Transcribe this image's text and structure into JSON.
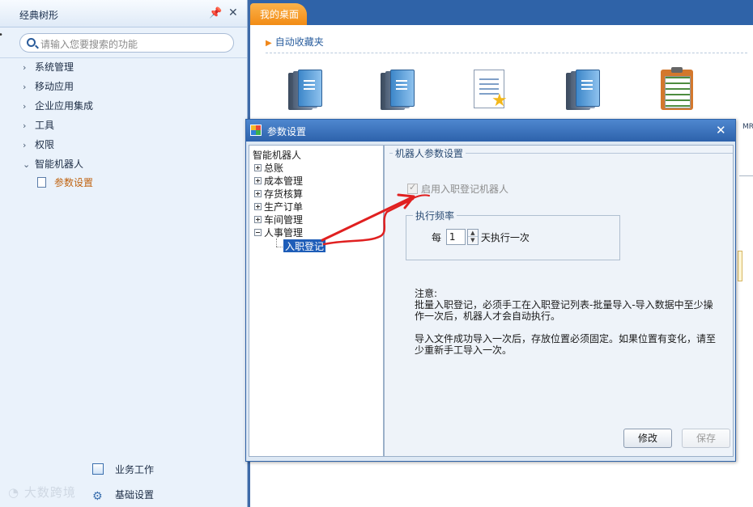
{
  "left_panel": {
    "title": "经典树形",
    "search_placeholder": "请输入您要搜索的功能",
    "menu": [
      {
        "label": "系统管理",
        "arrow": "›"
      },
      {
        "label": "移动应用",
        "arrow": "›"
      },
      {
        "label": "企业应用集成",
        "arrow": "›"
      },
      {
        "label": "工具",
        "arrow": "›"
      },
      {
        "label": "权限",
        "arrow": "›"
      },
      {
        "label": "智能机器人",
        "arrow": "⌄"
      }
    ],
    "submenu_item": "参数设置",
    "bottom": [
      {
        "label": "业务工作"
      },
      {
        "label": "基础设置"
      }
    ],
    "watermark": "大数跨境"
  },
  "tabs": [
    {
      "label": "我的桌面"
    }
  ],
  "favorites": {
    "header": "自动收藏夹",
    "partial_label": "MR",
    "icons": [
      "books-icon",
      "books-icon",
      "document-star-icon",
      "books-icon",
      "clipboard-icon"
    ]
  },
  "dialog": {
    "title": "参数设置",
    "tree": {
      "root": "智能机器人",
      "nodes": [
        {
          "label": "总账",
          "state": "collapsed"
        },
        {
          "label": "成本管理",
          "state": "collapsed"
        },
        {
          "label": "存货核算",
          "state": "collapsed"
        },
        {
          "label": "生产订单",
          "state": "collapsed"
        },
        {
          "label": "车间管理",
          "state": "collapsed"
        },
        {
          "label": "人事管理",
          "state": "expanded"
        }
      ],
      "selected_leaf": "入职登记"
    },
    "settings": {
      "group_title": "机器人参数设置",
      "enable_checkbox_label": "启用入职登记机器人",
      "enable_checked": true,
      "frequency": {
        "legend": "执行频率",
        "prefix": "每",
        "value": "1",
        "suffix": "天执行一次"
      },
      "note_title": "注意:",
      "note_lines": [
        "批量入职登记，必须手工在入职登记列表-批量导入-导入数据中至少操作一次后，机器人才会自动执行。",
        "导入文件成功导入一次后，存放位置必须固定。如果位置有变化，请至少重新手工导入一次。"
      ]
    },
    "buttons": {
      "modify": "修改",
      "save": "保存"
    }
  },
  "colors": {
    "tab_orange": "#f28c15",
    "title_blue": "#2d62ab",
    "selection_blue": "#1e5db8",
    "annotation_red": "#e02020"
  }
}
